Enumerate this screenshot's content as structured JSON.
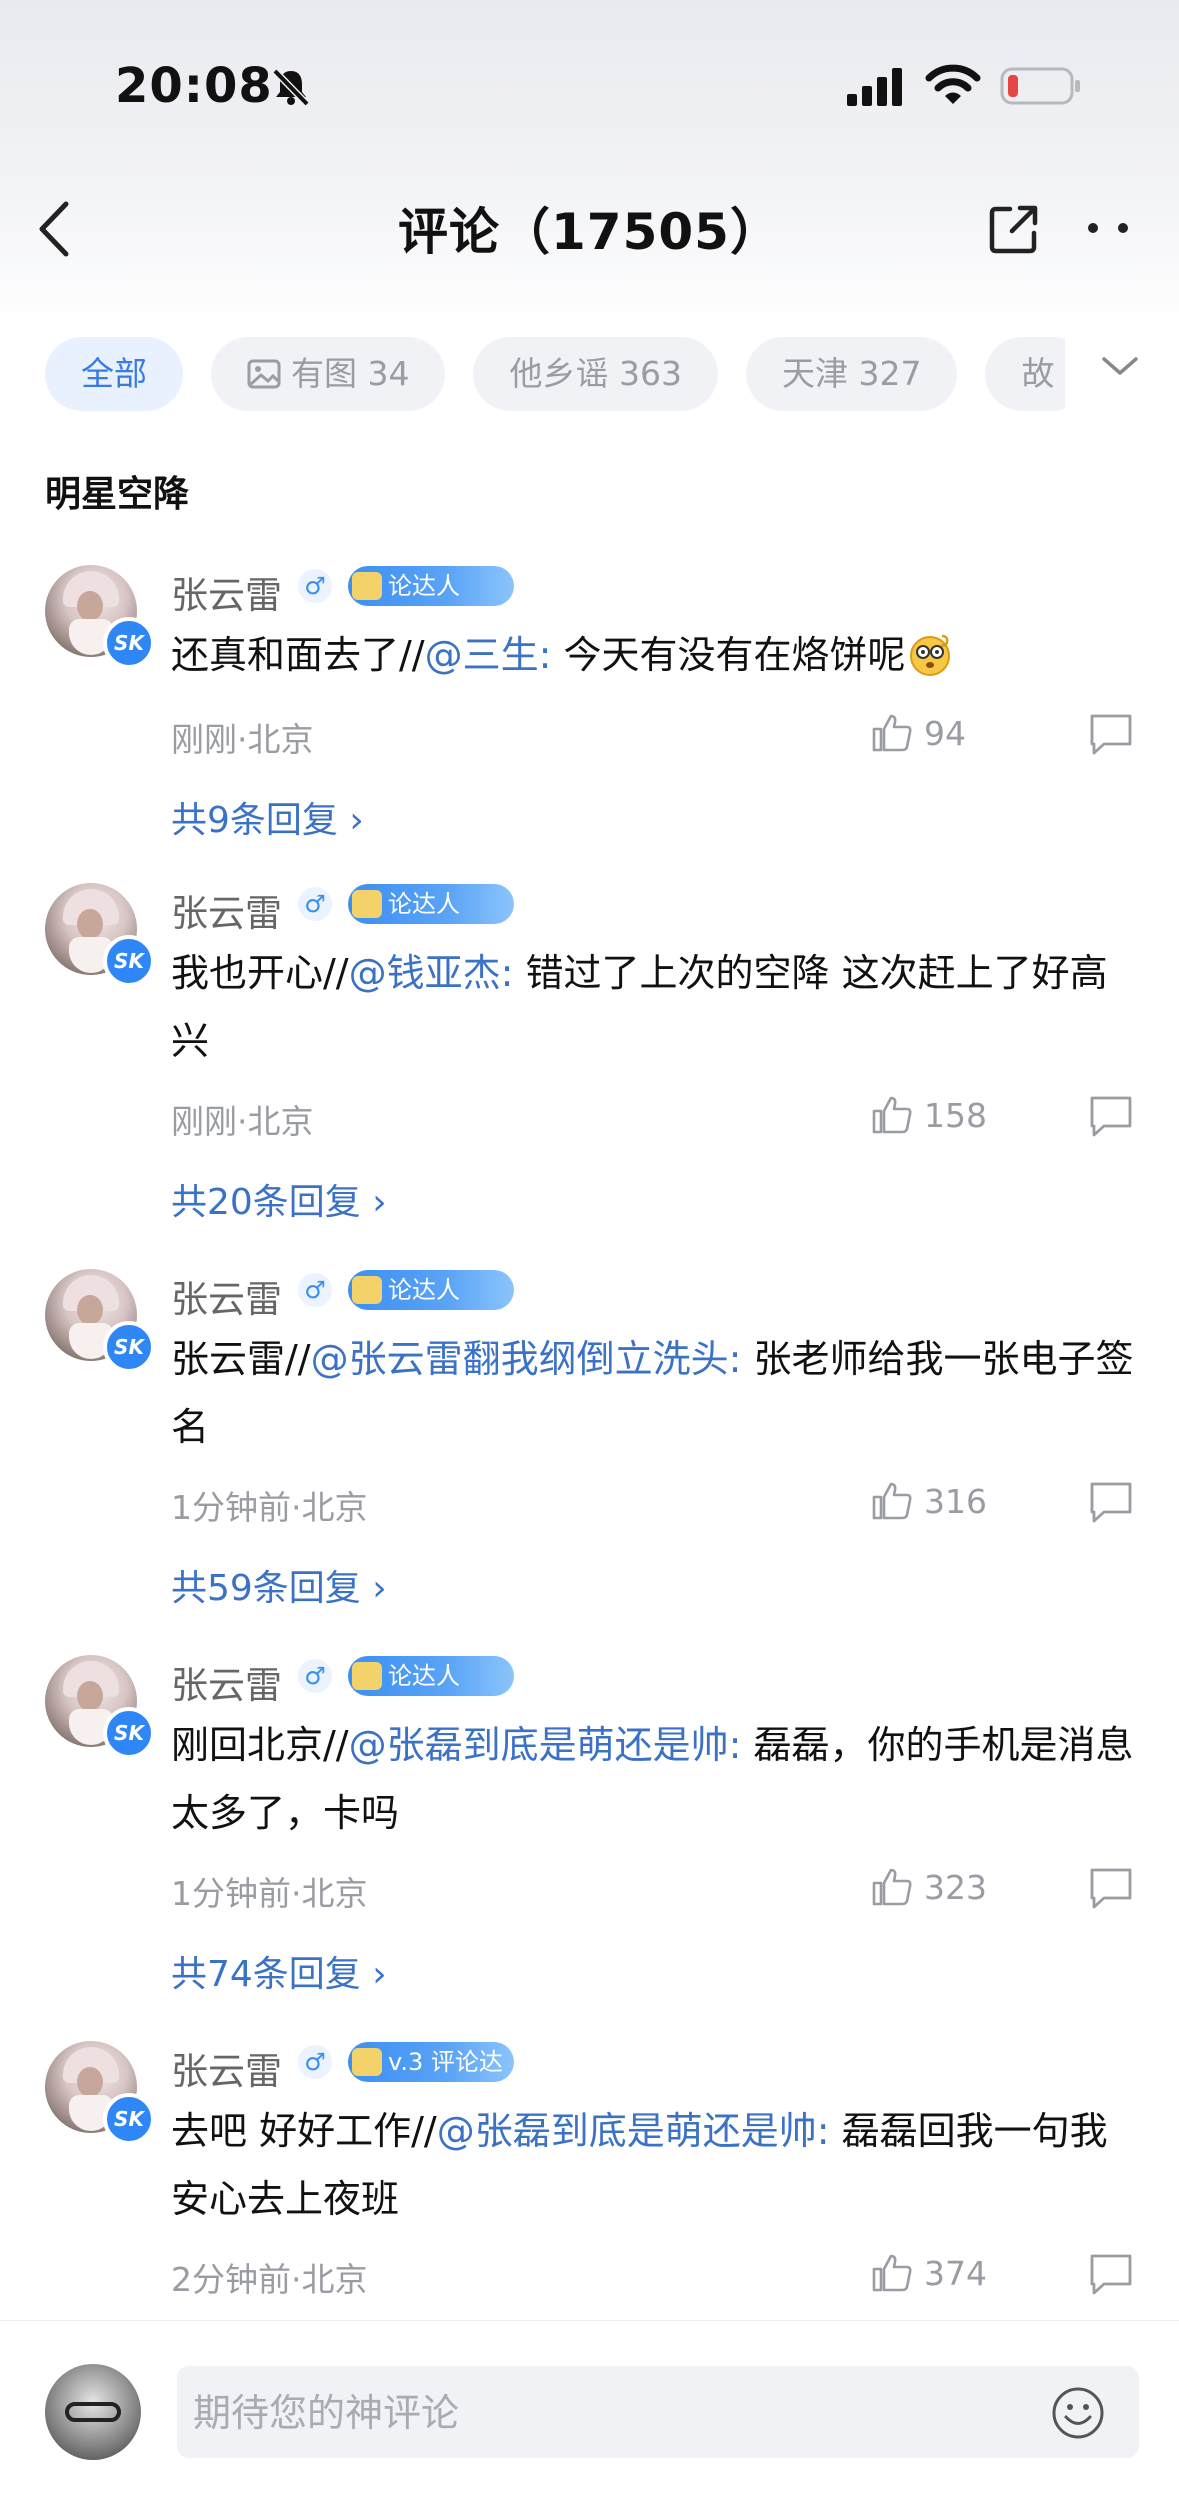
{
  "status_bar": {
    "time": "20:08",
    "icons": [
      "bell-slash-icon",
      "signal-icon",
      "wifi-icon",
      "battery-low-icon"
    ],
    "battery_color": "#e64545"
  },
  "nav": {
    "title": "评论（17505）",
    "icons": [
      "back-icon",
      "share-icon",
      "more-icon"
    ]
  },
  "filters": {
    "chips": [
      {
        "label": "全部",
        "active": true
      },
      {
        "label": "有图 34",
        "icon": "image-icon"
      },
      {
        "label": "他乡谣 363"
      },
      {
        "label": "天津 327"
      },
      {
        "label": "故"
      }
    ],
    "expand_icon": "chevron-down-icon"
  },
  "section_title": "明星空降",
  "comments": [
    {
      "name": "张云雷",
      "gender": "♂",
      "badge": "论达人",
      "body": "还真和面去了//",
      "mention": "@三生:",
      "quote": " 今天有没有在烙饼呢",
      "emoji": "dizzy-face-emoji",
      "meta": "刚刚·北京",
      "likes": "94",
      "replies": "共9条回复 ›"
    },
    {
      "name": "张云雷",
      "gender": "♂",
      "badge": "论达人",
      "body": "我也开心//",
      "mention": "@钱亚杰:",
      "quote": " 错过了上次的空降 这次赶上了好高兴",
      "meta": "刚刚·北京",
      "likes": "158",
      "replies": "共20条回复 ›"
    },
    {
      "name": "张云雷",
      "gender": "♂",
      "badge": "论达人",
      "body": "张云雷//",
      "mention": "@张云雷翻我纲倒立洗头:",
      "quote": " 张老师给我一张电子签名",
      "meta": "1分钟前·北京",
      "likes": "316",
      "replies": "共59条回复 ›"
    },
    {
      "name": "张云雷",
      "gender": "♂",
      "badge": "论达人",
      "body": "刚回北京//",
      "mention": "@张磊到底是萌还是帅:",
      "quote": " 磊磊，你的手机是消息太多了，卡吗",
      "meta": "1分钟前·北京",
      "likes": "323",
      "replies": "共74条回复 ›"
    },
    {
      "name": "张云雷",
      "gender": "♂",
      "badge": "v.3 评论达",
      "body": "去吧 好好工作//",
      "mention": "@张磊到底是萌还是帅:",
      "quote": " 磊磊回我一句我安心去上夜班",
      "meta": "2分钟前·北京",
      "likes": "374"
    }
  ],
  "composer": {
    "placeholder": "期待您的神评论",
    "emoji_icon": "smile-icon"
  },
  "colors": {
    "accent": "#3a7be0",
    "mention": "#3b72c6",
    "muted": "#9a9ca3",
    "verified": "#2f86f6"
  }
}
